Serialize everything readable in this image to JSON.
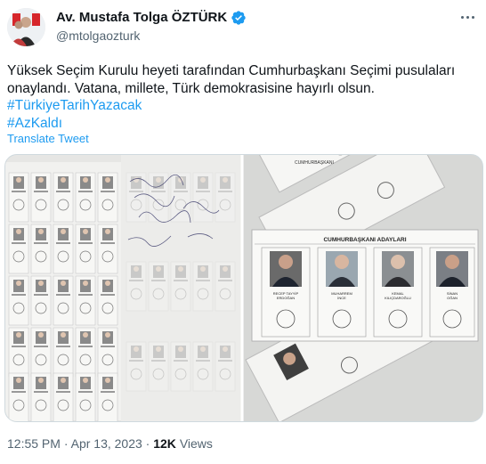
{
  "author": {
    "name": "Av. Mustafa Tolga ÖZTÜRK",
    "handle": "@mtolgaozturk",
    "verified": true
  },
  "tweet": {
    "text": "Yüksek Seçim Kurulu heyeti tarafından Cumhurbaşkanı Seçimi pusulaları onaylandı. Vatana, millete, Türk demokrasisine hayırlı olsun.",
    "hashtags": [
      "#TürkiyeTarihYazacak",
      "#AzKaldı"
    ],
    "translate_label": "Translate Tweet"
  },
  "media": {
    "ballot_title": "CUMHURBAŞKANI ADAYLARI",
    "ballot_partial_title": "CUMHURBAŞKANI",
    "candidates": [
      {
        "name_line1": "RECEP TAYYİP",
        "name_line2": "ERDOĞAN"
      },
      {
        "name_line1": "MUHARREM",
        "name_line2": "İNCE"
      },
      {
        "name_line1": "KEMAL",
        "name_line2": "KILIÇDAROĞLU"
      },
      {
        "name_line1": "SİNAN",
        "name_line2": "OĞAN"
      }
    ]
  },
  "meta": {
    "time": "12:55 PM",
    "date": "Apr 13, 2023",
    "views_count": "12K",
    "views_label": "Views"
  },
  "colors": {
    "link": "#1d9bf0",
    "verified": "#1d9bf0",
    "secondary": "#536471"
  }
}
